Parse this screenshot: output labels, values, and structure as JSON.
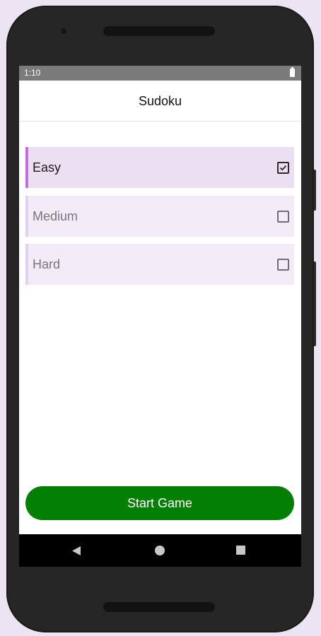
{
  "status_bar": {
    "time": "1:10",
    "battery_icon": "battery-full-icon"
  },
  "app_bar": {
    "title": "Sudoku"
  },
  "difficulty_options": [
    {
      "label": "Easy",
      "checked": true
    },
    {
      "label": "Medium",
      "checked": false
    },
    {
      "label": "Hard",
      "checked": false
    }
  ],
  "start_button": {
    "label": "Start Game",
    "color": "#037f03"
  },
  "nav_bar": {
    "back_icon": "back-triangle-icon",
    "home_icon": "home-circle-icon",
    "recent_icon": "recent-apps-square-icon"
  },
  "colors": {
    "accent": "#c06fdc",
    "option_selected_bg": "#ebdff1",
    "option_bg": "#f3ecf8",
    "page_bg": "#ece3f3"
  }
}
